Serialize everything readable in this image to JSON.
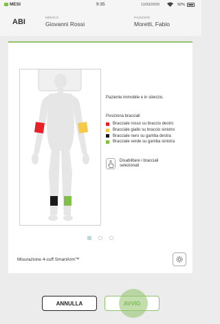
{
  "status_bar": {
    "app_name": "MESI",
    "time": "9:35",
    "date": "11/03/2020",
    "battery": "92%",
    "wifi_icon": "wifi-icon",
    "battery_icon": "battery-icon"
  },
  "header": {
    "abi": "ABI",
    "doctor_label": "MEDICO",
    "doctor_name": "Giovanni Rossi",
    "patient_label": "PAZIENTE",
    "patient_name": "Moretti, Fabio"
  },
  "main": {
    "info_text": "Paziente immobile e in silenzio.",
    "legend_title": "Posiziona bracciali",
    "legend": [
      {
        "label": "Bracciale rosso su braccio destro",
        "color": "#e8202a"
      },
      {
        "label": "Bracciale giallo su braccio sinistro",
        "color": "#f7c948"
      },
      {
        "label": "Bracciale nero su gamba destra",
        "color": "#1a1a1a"
      },
      {
        "label": "Bracciale verde su gamba sinistra",
        "color": "#7fc241"
      }
    ],
    "disable_label": "Disabilitare i bracciali selezionati",
    "mode_label": "Misurazione 4-cuff SmartArm™",
    "pager_active": 0
  },
  "footer": {
    "cancel_label": "ANNULLA",
    "start_label": "AVVIO"
  },
  "colors": {
    "accent_green": "#8fc26a",
    "cuff_red": "#e8202a",
    "cuff_yellow": "#f7c948",
    "cuff_black": "#1a1a1a",
    "cuff_green": "#7fc241"
  }
}
